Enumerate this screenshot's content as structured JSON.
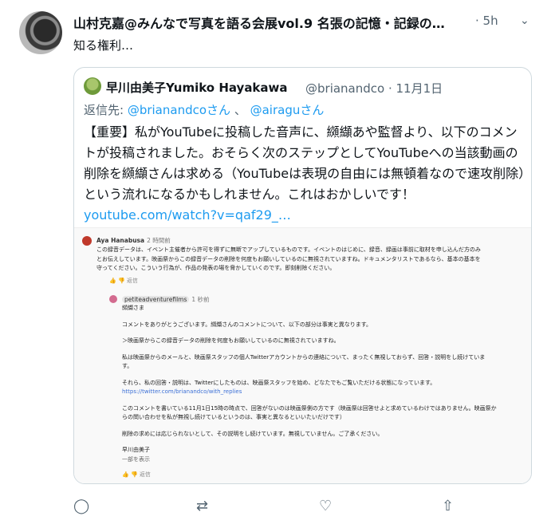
{
  "tweet": {
    "author": "山村克嘉@みんなで写真を語る会展vol.9 名張の記憶・記録の…",
    "time": "5h",
    "text": "知る権利…"
  },
  "quote": {
    "name": "早川由美子Yumiko Hayakawa",
    "handle": "@brianandco · 11月1日",
    "reply_prefix": "返信先: ",
    "reply_handle1": "@brianandcoさん",
    "reply_sep": "、",
    "reply_handle2": "@airaguさん",
    "body": "【重要】私がYouTubeに投稿した音声に、纐纈あや監督より、以下のコメントが投稿されました。おそらく次のステップとしてYouTubeへの当該動画の削除を纐纈さんは求める（YouTubeは表現の自由には無頓着なので速攻削除）という流れになるかもしれません。これはおかしいです！ ",
    "link": "youtube.com/watch?v=qaf29_…"
  },
  "screenshot": {
    "c1_author": "Aya Hanabusa",
    "c1_time": "2 時間前",
    "c1_line1": "この録音データは、イベント主催者から許可を得ずに無断でアップしているものです。イベントのはじめに、録音、録画は事前に取材を申し込んだ方のみ",
    "c1_line2": "とお伝えしています。映画祭からこの録音データの削除を何度もお願いしているのに無視されていますね。ドキュメンタリストであるなら、基本の基本を",
    "c1_line3": "守ってください。こういう行為が、作品の発表の場を脅かしていくのです。即刻削除ください。",
    "reply_label": "返信",
    "c2_author": "petiteadventurefilms",
    "c2_time": "1 秒前",
    "c2_l1": "纐纈さま",
    "c2_l2": "コメントをありがとうございます。纐纈さんのコメントについて、以下の部分は事実と異なります。",
    "c2_l3": "＞映画祭からこの録音データの削除を何度もお願いしているのに無視されていますね。",
    "c2_l4": "私は映画祭からのメールと、映画祭スタッフの個人Twitterアカウントからの連絡について、まったく無視しておらず、回答・説明をし続けていま",
    "c2_l5": "す。",
    "c2_l6": "それら、私の回答・説明は、Twitterにしたものは、映画祭スタッフを始め、どなたでもご覧いただける状態になっています。",
    "c2_link": "https://twitter.com/brianandco/with_replies",
    "c2_l7": "このコメントを書いている11月1日15時の時点で、回答がないのは映画祭側の方です（映画祭は回答せよと求めているわけではありません。映画祭か",
    "c2_l8": "らの問い合わせを私が無視し続けているというのは、事実と異なるといいたいだけです）",
    "c2_l9": "削除の求めには応じられないとして、その説明をし続けています。無視していません。ご了承ください。",
    "c2_sign": "早川由美子",
    "c2_more": "一部を表示",
    "thumbs": "👍 👎"
  },
  "actions": {
    "reply_icon": "◯",
    "retweet_icon": "⇄",
    "like_icon": "♡",
    "share_icon": "⇧"
  }
}
